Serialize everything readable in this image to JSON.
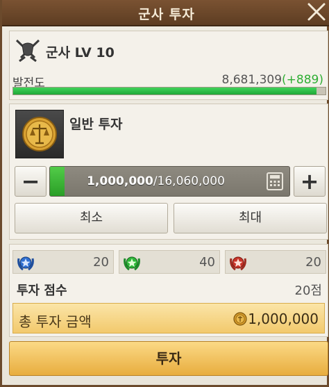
{
  "window": {
    "title": "군사 투자"
  },
  "level": {
    "title": "군사 LV 10"
  },
  "development": {
    "label": "발전도",
    "value": "8,681,309",
    "gain": "(+889)",
    "progress": 0.97
  },
  "investment": {
    "title": "일반 투자",
    "current": "1,000,000",
    "separator": "/",
    "max": "16,060,000",
    "fill_fraction": 0.0623,
    "min_label": "최소",
    "max_label": "최대"
  },
  "ranks": [
    {
      "color": "blue",
      "value": "20"
    },
    {
      "color": "green",
      "value": "40"
    },
    {
      "color": "red",
      "value": "20"
    }
  ],
  "score": {
    "label": "투자 점수",
    "value": "20점"
  },
  "total": {
    "label": "총 투자 금액",
    "value": "1,000,000"
  },
  "actions": {
    "invest_label": "투자"
  },
  "colors": {
    "accent_green": "#2fae34",
    "button_gold": "#e8ad3e",
    "title_brown": "#5d3d22",
    "rank_blue": "#2f6fd0",
    "rank_green": "#2fb83a",
    "rank_red": "#c8352a"
  }
}
